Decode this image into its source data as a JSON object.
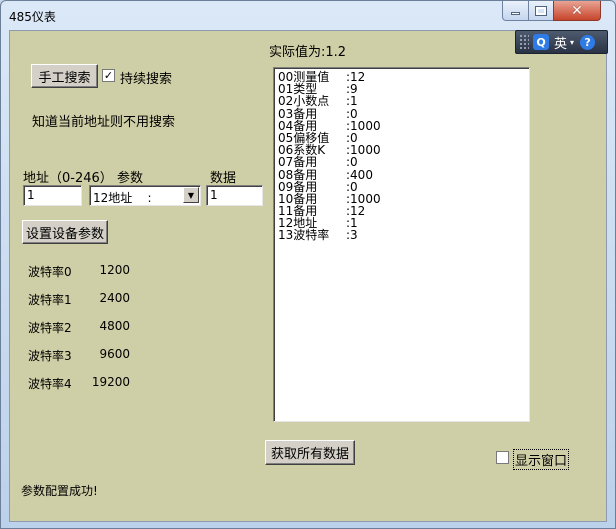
{
  "window": {
    "title": "485仪表",
    "close_glyph": "✕"
  },
  "header": {
    "actual_value": "实际值为:1.2"
  },
  "search": {
    "manual_button": "手工搜索",
    "continuous_label": "持续搜索",
    "continuous_checked_glyph": "✓",
    "hint": "知道当前地址则不用搜索"
  },
  "params": {
    "address_label": "地址（0-246）",
    "param_label": "参数",
    "data_label": "数据",
    "address_value": "1",
    "param_selected": "12地址    :",
    "data_value": "1",
    "set_button": "设置设备参数"
  },
  "baud_rates": [
    {
      "name": "波特率0",
      "value": "1200"
    },
    {
      "name": "波特率1",
      "value": "2400"
    },
    {
      "name": "波特率2",
      "value": "4800"
    },
    {
      "name": "波特率3",
      "value": "9600"
    },
    {
      "name": "波特率4",
      "value": "19200"
    }
  ],
  "list_items": [
    {
      "name": "00测量值",
      "value": ":12"
    },
    {
      "name": "01类型",
      "value": ":9"
    },
    {
      "name": "02小数点",
      "value": ":1"
    },
    {
      "name": "03备用",
      "value": ":0"
    },
    {
      "name": "04备用",
      "value": ":1000"
    },
    {
      "name": "05偏移值",
      "value": ":0"
    },
    {
      "name": "06系数K",
      "value": ":1000"
    },
    {
      "name": "07备用",
      "value": ":0"
    },
    {
      "name": "08备用",
      "value": ":400"
    },
    {
      "name": "09备用",
      "value": ":0"
    },
    {
      "name": "10备用",
      "value": ":1000"
    },
    {
      "name": "11备用",
      "value": ":12"
    },
    {
      "name": "12地址",
      "value": ":1"
    },
    {
      "name": "13波特率",
      "value": ":3"
    }
  ],
  "footer": {
    "get_all_button": "获取所有数据",
    "show_window_label": "显示窗口",
    "status": "参数配置成功!"
  },
  "ime": {
    "logo": "Q",
    "language": "英",
    "dropdown_glyph": "▾",
    "help_glyph": "?"
  },
  "colors": {
    "client_bg": "#cfcfa7",
    "title_close": "#c7452c"
  }
}
